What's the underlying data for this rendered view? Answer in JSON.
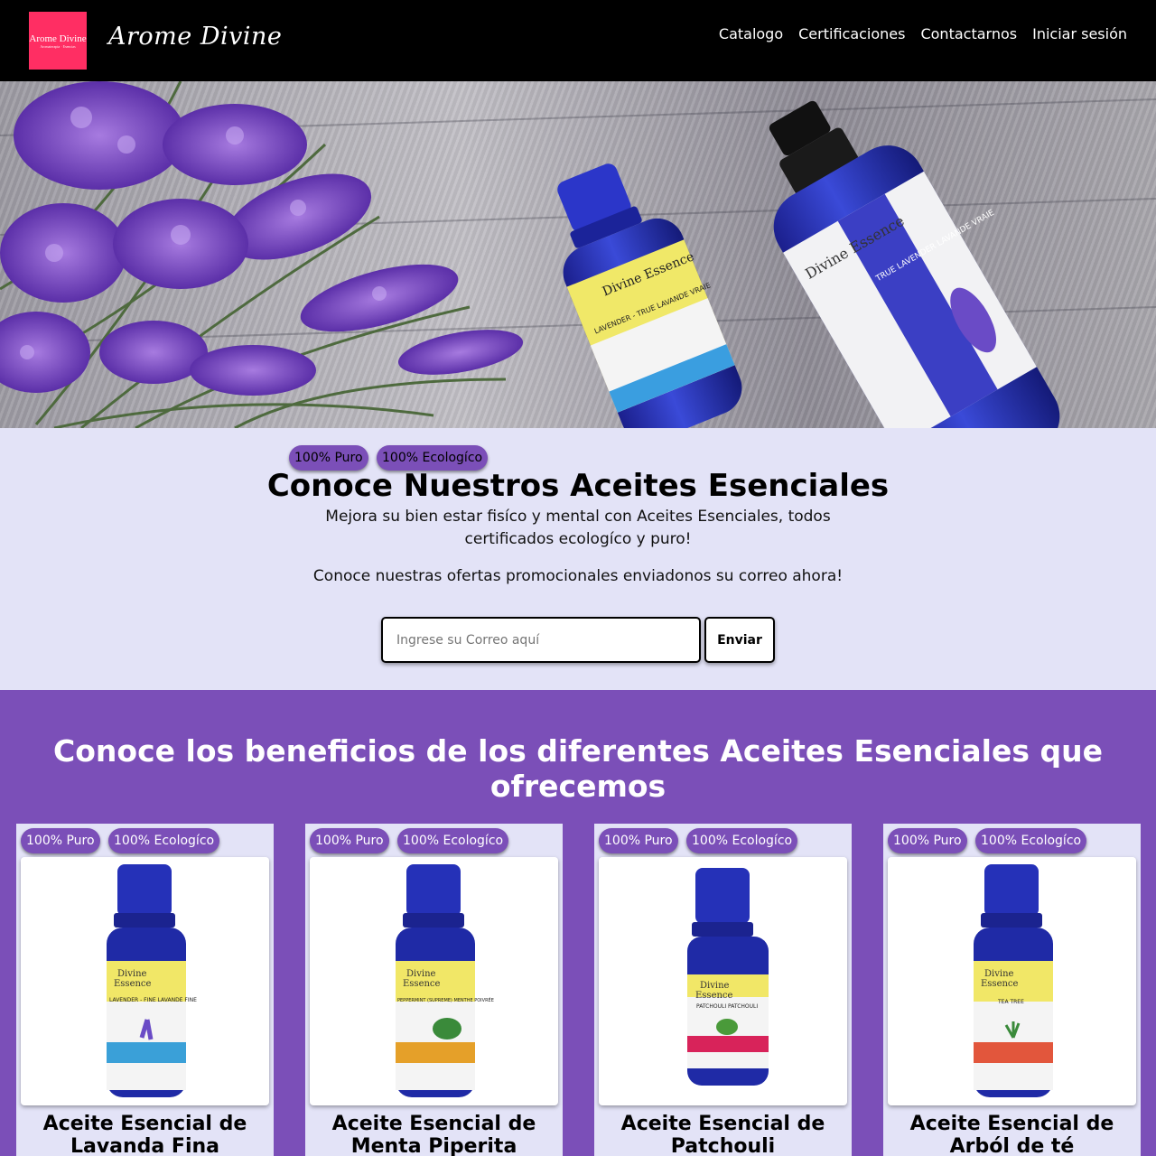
{
  "header": {
    "logo_text": "Arome Divine",
    "logo_sub": "Aromaterapia · Esencias",
    "brand": "Arome Divine",
    "nav": [
      "Catalogo",
      "Certificaciones",
      "Contactarnos",
      "Iniciar sesión"
    ]
  },
  "hero": {
    "bottle_small_brand": "Divine Essence",
    "bottle_small_label": "LAVENDER - TRUE LAVANDE VRAIE",
    "bottle_large_brand": "Divine Essence",
    "bottle_large_label": "TRUE LAVENDER LAVANDE VRAIE"
  },
  "promo": {
    "badges": [
      "100% Puro",
      "100% Ecologíco"
    ],
    "title": "Conoce Nuestros Aceites Esenciales",
    "subtitle": "Mejora su bien estar fisíco y mental con Aceites Esenciales, todos certificados ecologíco y puro!",
    "offer": "Conoce nuestras ofertas promocionales enviadonos su correo ahora!",
    "email_placeholder": "Ingrese su Correo aquí",
    "send_label": "Enviar"
  },
  "benefits": {
    "title": "Conoce los beneficios de los diferentes Aceites Esenciales que ofrecemos",
    "products": [
      {
        "name": "Aceite Esencial de Lavanda Fina",
        "label": "LAVENDER - FINE LAVANDE FINE",
        "band_color": "#3aa0d8",
        "badges": [
          "100% Puro",
          "100% Ecologíco"
        ]
      },
      {
        "name": "Aceite Esencial de Menta Piperita",
        "label": "PEPPERMINT (SUPREME) MENTHE POIVRÉE",
        "band_color": "#e5a029",
        "badges": [
          "100% Puro",
          "100% Ecologíco"
        ]
      },
      {
        "name": "Aceite Esencial de Patchouli",
        "label": "PATCHOULI PATCHOULI",
        "band_color": "#d8235a",
        "badges": [
          "100% Puro",
          "100% Ecologíco"
        ]
      },
      {
        "name": "Aceite Esencial de Arból de té",
        "label": "TEA TREE",
        "band_color": "#e2563c",
        "badges": [
          "100% Puro",
          "100% Ecologíco"
        ]
      }
    ]
  },
  "colors": {
    "brand_purple": "#7b4fb8",
    "lavender_bg": "#e3e3f7",
    "logo_pink": "#ff2e63"
  }
}
